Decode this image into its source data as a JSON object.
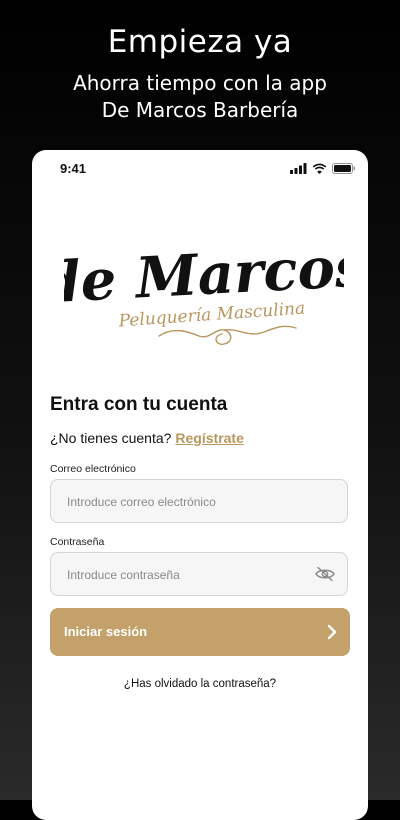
{
  "promo": {
    "title": "Empieza ya",
    "subtitle_line1": "Ahorra tiempo con la app",
    "subtitle_line2": "De Marcos Barbería"
  },
  "status_bar": {
    "time": "9:41",
    "icons": [
      "signal-icon",
      "wifi-icon",
      "battery-icon"
    ]
  },
  "logo": {
    "name": "de Marcos",
    "tagline": "Peluquería Masculina",
    "accent_color": "#b8975f"
  },
  "login": {
    "title": "Entra con tu cuenta",
    "no_account_text": "¿No tienes cuenta?",
    "signup_link": "Regístrate",
    "email_label": "Correo electrónico",
    "email_placeholder": "Introduce correo electrónico",
    "password_label": "Contraseña",
    "password_placeholder": "Introduce contraseña",
    "password_toggle_icon": "eye-off-icon",
    "submit_label": "Iniciar sesión",
    "submit_icon": "chevron-right-icon",
    "forgot_password": "¿Has olvidado la contraseña?"
  },
  "colors": {
    "brand_gold": "#c4a06b",
    "link_gold": "#b8975f",
    "background_dark": "#000000"
  }
}
